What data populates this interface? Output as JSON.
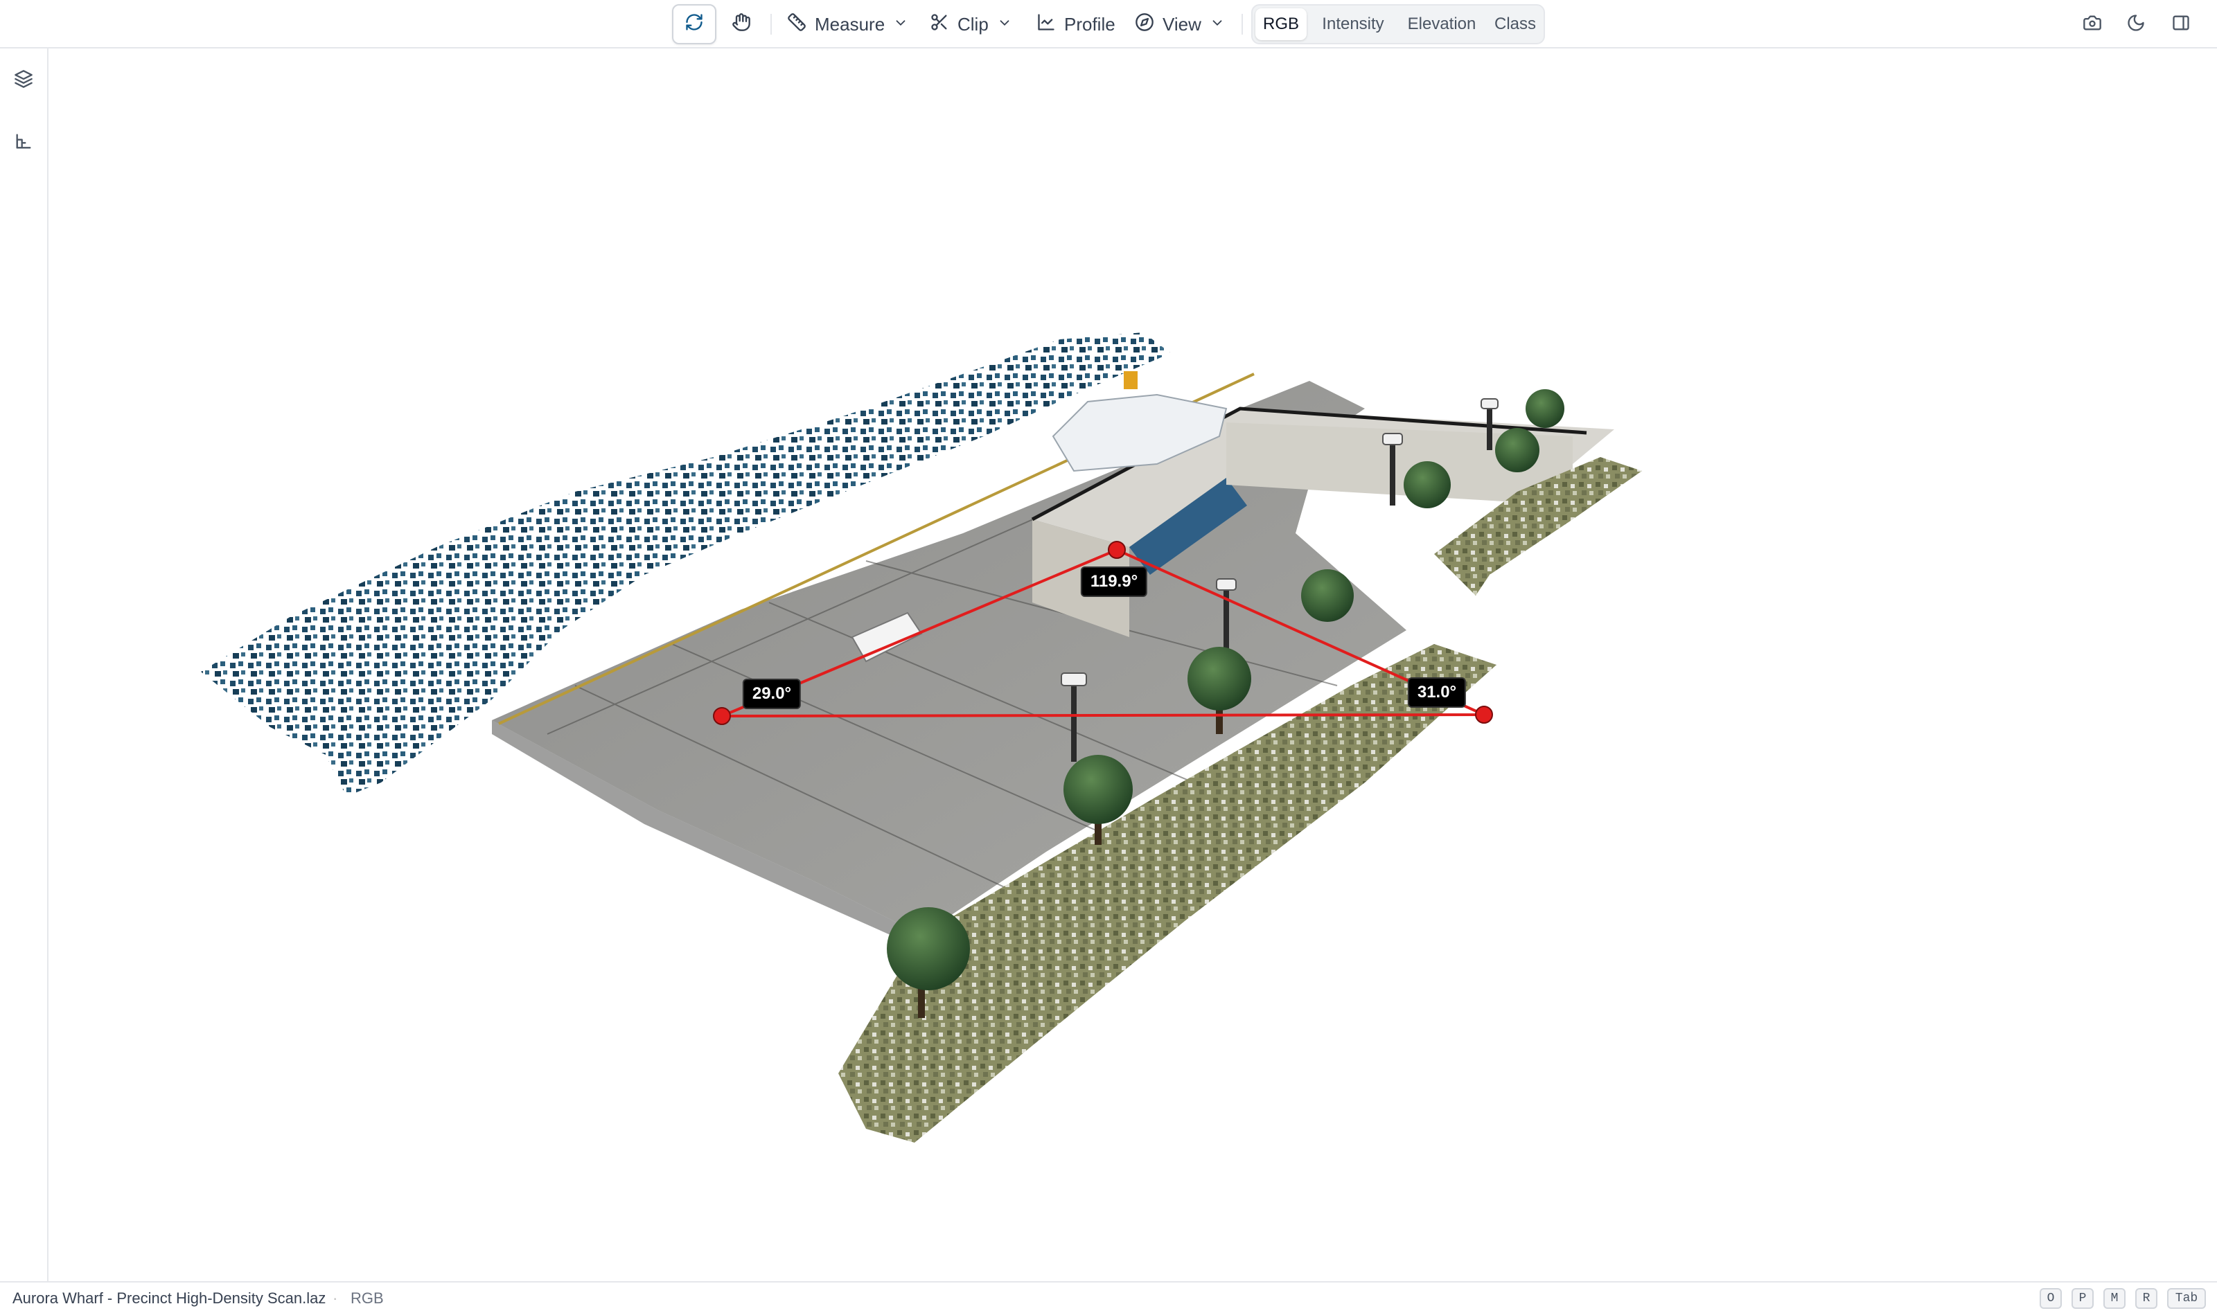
{
  "toolbar": {
    "measure_label": "Measure",
    "clip_label": "Clip",
    "profile_label": "Profile",
    "view_label": "View",
    "color_modes": [
      "RGB",
      "Intensity",
      "Elevation",
      "Class"
    ],
    "selected_color_mode": "RGB",
    "left_icons": [
      "refresh-orbit-icon",
      "pan-hand-icon"
    ],
    "right_icons": [
      "camera-icon",
      "moon-icon",
      "panel-toggle-icon"
    ]
  },
  "sidebar": {
    "items": [
      {
        "icon": "layers-icon"
      },
      {
        "icon": "ruler-measure-icon"
      }
    ]
  },
  "measurement": {
    "type": "angle",
    "color": "#e11d1d",
    "angles": [
      "29.0°",
      "119.9°",
      "31.0°"
    ]
  },
  "status": {
    "file_name": "Aurora Wharf - Precinct High-Density Scan.laz",
    "mode": "RGB",
    "shortcuts": [
      "O",
      "P",
      "M",
      "R",
      "Tab"
    ]
  },
  "colors": {
    "water": "#1e4a66",
    "ground": "#8a8a88",
    "grass": "#6b6f4a",
    "tree": "#2f5a32",
    "measure": "#e11d1d"
  }
}
